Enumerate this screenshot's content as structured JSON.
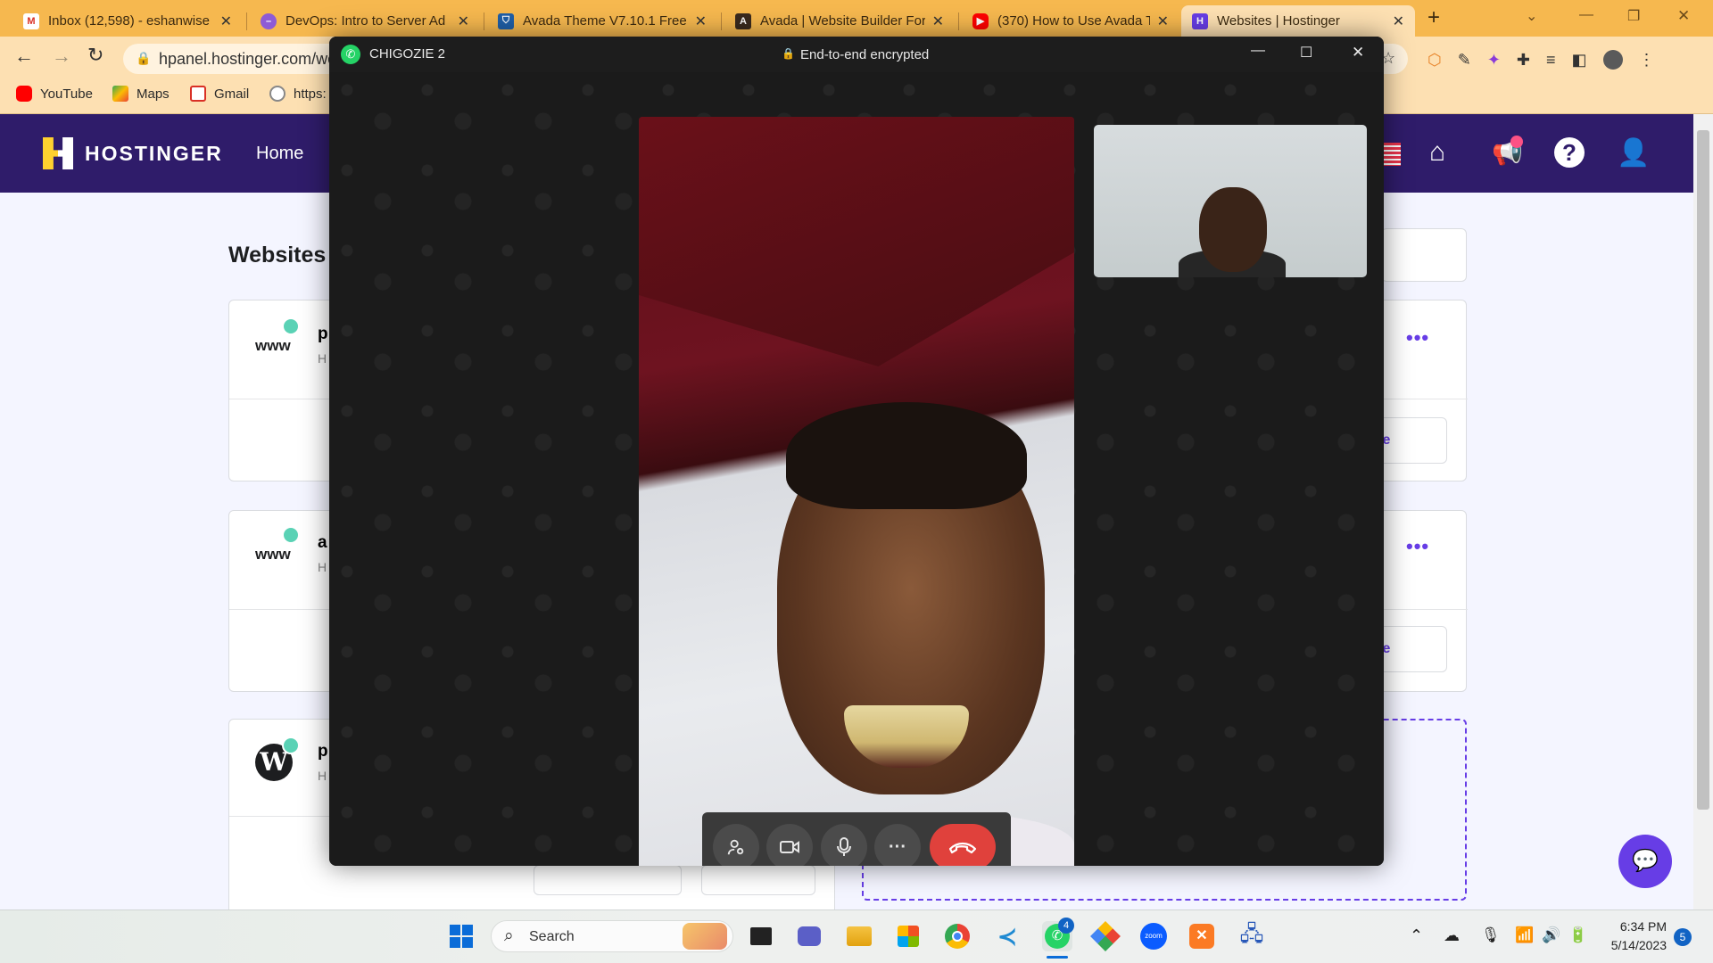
{
  "browser": {
    "tabs": [
      {
        "title": "Inbox (12,598) - eshanwise",
        "favicon": "gmail-icon",
        "active": false
      },
      {
        "title": "DevOps: Intro to Server Ad",
        "favicon": "course-icon",
        "active": false
      },
      {
        "title": "Avada Theme V7.10.1 Free",
        "favicon": "shield-icon",
        "active": false
      },
      {
        "title": "Avada | Website Builder For",
        "favicon": "avada-icon",
        "active": false
      },
      {
        "title": "(370) How to Use Avada Th",
        "favicon": "youtube-icon",
        "active": false
      },
      {
        "title": "Websites | Hostinger",
        "favicon": "hostinger-icon",
        "active": true
      }
    ],
    "new_tab": "+",
    "url": "hpanel.hostinger.com/we",
    "bookmarks": [
      {
        "label": "YouTube",
        "icon": "youtube-icon"
      },
      {
        "label": "Maps",
        "icon": "maps-icon"
      },
      {
        "label": "Gmail",
        "icon": "gmail-icon"
      },
      {
        "label": "https:",
        "icon": "github-icon"
      }
    ]
  },
  "hostinger": {
    "brand": "HOSTINGER",
    "nav_home": "Home",
    "page_title": "Websites",
    "cards": [
      {
        "icon": "www",
        "name_initial": "p",
        "sub_initial": "H",
        "manage": "nage"
      },
      {
        "icon": "www",
        "name_initial": "a",
        "sub_initial": "H",
        "manage": "nage"
      },
      {
        "icon": "wordpress",
        "name_initial": "p",
        "sub_initial": "H",
        "manage": ""
      }
    ],
    "more": "•••"
  },
  "whatsapp_call": {
    "contact": "CHIGOZIE 2",
    "encryption": "End-to-end encrypted",
    "controls": [
      "add-participant",
      "video",
      "microphone",
      "more",
      "end-call"
    ],
    "more_label": "···"
  },
  "taskbar": {
    "search_placeholder": "Search",
    "whatsapp_badge": "4",
    "time": "6:34 PM",
    "date": "5/14/2023",
    "notification_count": "5"
  },
  "colors": {
    "tab_strip": "#f6b84f",
    "toolbar": "#fde0b2",
    "hostinger_header": "#2f1c6a",
    "hostinger_accent": "#673de6",
    "status_dot": "#5ad2b5",
    "end_call": "#e0413c"
  }
}
